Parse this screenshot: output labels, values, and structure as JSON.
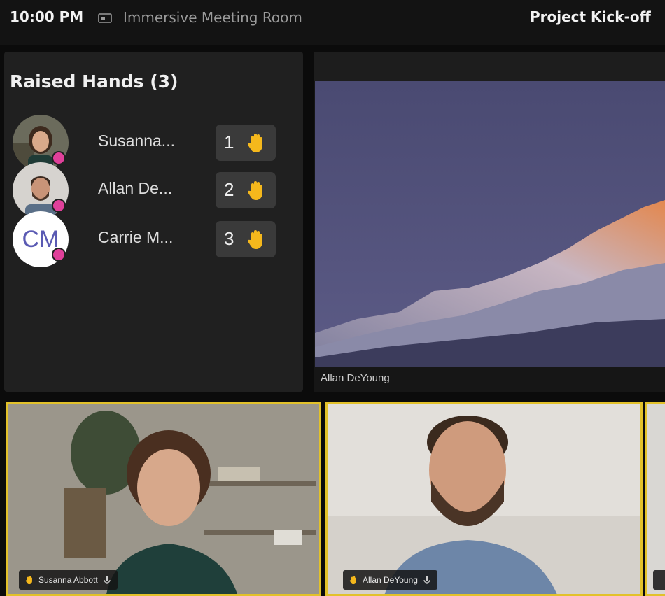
{
  "topbar": {
    "time": "10:00 PM",
    "room_icon": "screen-share-icon",
    "room_name": "Immersive Meeting Room",
    "meeting_title": "Project Kick-off"
  },
  "raised_hands": {
    "title": "Raised Hands (3)",
    "items": [
      {
        "name": "Susanna...",
        "order": "1",
        "avatar_type": "photo",
        "hand_icon": "raised-hand-icon",
        "presence_color": "#e0409a"
      },
      {
        "name": "Allan De...",
        "order": "2",
        "avatar_type": "photo",
        "hand_icon": "raised-hand-icon",
        "presence_color": "#e0409a"
      },
      {
        "name": "Carrie M...",
        "order": "3",
        "avatar_type": "initials",
        "initials": "CM",
        "hand_icon": "raised-hand-icon",
        "presence_color": "#e0409a"
      }
    ]
  },
  "shared_content": {
    "caption": "Allan DeYoung"
  },
  "tiles": [
    {
      "name": "Susanna Abbott",
      "hand_icon": "raised-hand-icon",
      "mic_icon": "microphone-icon"
    },
    {
      "name": "Allan DeYoung",
      "hand_icon": "raised-hand-icon",
      "mic_icon": "microphone-icon"
    }
  ],
  "colors": {
    "accent_yellow": "#e2c12a",
    "hand_yellow": "#f5b81c",
    "presence_pink": "#e0409a",
    "panel_bg": "#202020",
    "page_bg": "#0b0b0b"
  }
}
